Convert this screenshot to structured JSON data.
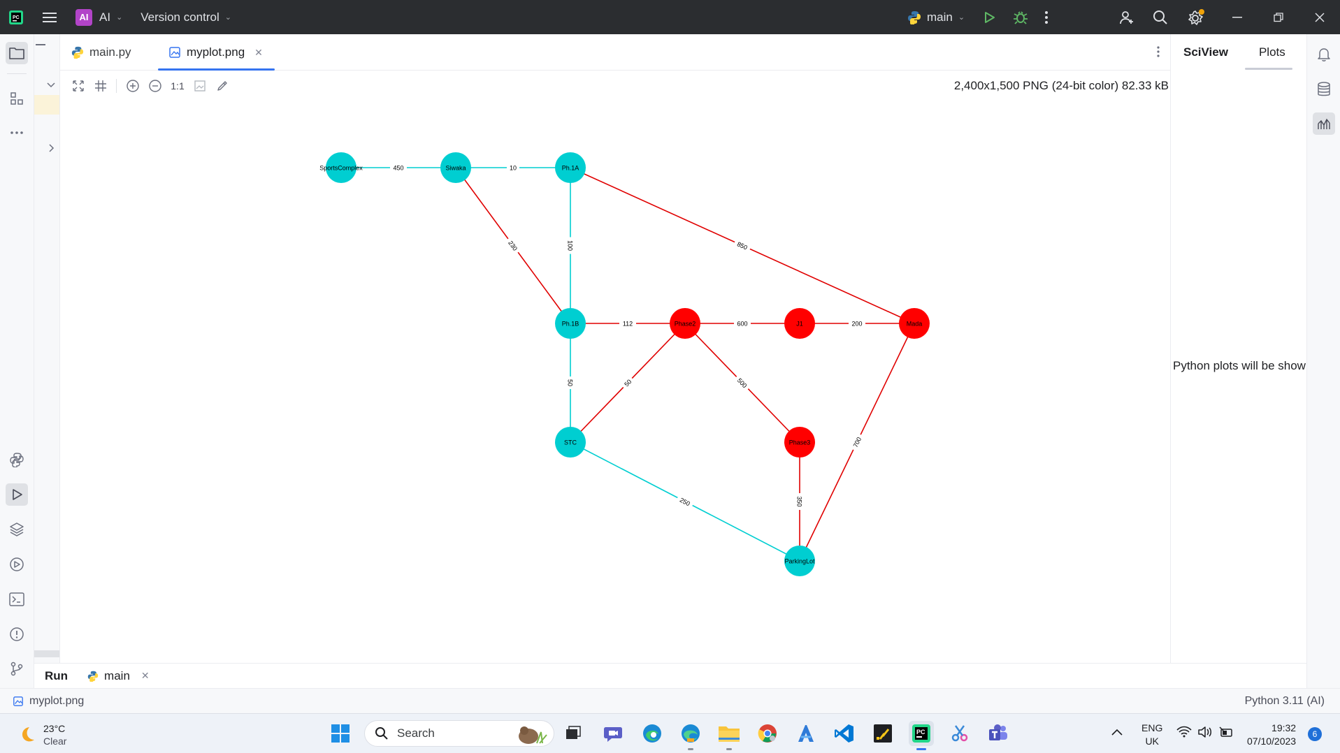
{
  "titlebar": {
    "project_badge": "AI",
    "project_name": "AI",
    "vcs_label": "Version control",
    "run_config": "main"
  },
  "tabs": [
    {
      "label": "main.py",
      "active": false
    },
    {
      "label": "myplot.png",
      "active": true
    }
  ],
  "image_toolbar": {
    "actual_size_label": "1:1",
    "image_info": "2,400x1,500 PNG (24-bit color) 82.33 kB"
  },
  "sciview": {
    "tab_sciview": "SciView",
    "tab_plots": "Plots",
    "empty_message": "Python plots will be shown here"
  },
  "runbar": {
    "run_label": "Run",
    "run_tab": "main"
  },
  "statusbar": {
    "file": "myplot.png",
    "interpreter": "Python 3.11 (AI)"
  },
  "taskbar": {
    "weather_temp": "23°C",
    "weather_desc": "Clear",
    "search_label": "Search",
    "lang_1": "ENG",
    "lang_2": "UK",
    "time": "19:32",
    "date": "07/10/2023",
    "notification_count": "6"
  },
  "colors": {
    "cyan_node": "#00ced1",
    "red_node": "#ff0000",
    "cyan_edge": "#00ced1",
    "red_edge": "#e00000",
    "accent": "#3574f0"
  },
  "graph": {
    "nodes": [
      {
        "id": "SportsComplex",
        "label": "SportsComplex",
        "color": "cyan"
      },
      {
        "id": "Siwaka",
        "label": "Siwaka",
        "color": "cyan"
      },
      {
        "id": "Ph.1A",
        "label": "Ph.1A",
        "color": "cyan"
      },
      {
        "id": "Ph.1B",
        "label": "Ph.1B",
        "color": "cyan"
      },
      {
        "id": "Phase2",
        "label": "Phase2",
        "color": "red"
      },
      {
        "id": "J1",
        "label": "J1",
        "color": "red"
      },
      {
        "id": "Mada",
        "label": "Mada",
        "color": "red"
      },
      {
        "id": "STC",
        "label": "STC",
        "color": "cyan"
      },
      {
        "id": "Phase3",
        "label": "Phase3",
        "color": "red"
      },
      {
        "id": "ParkingLot",
        "label": "ParkingLot",
        "color": "cyan"
      }
    ],
    "edges": [
      {
        "from": "SportsComplex",
        "to": "Siwaka",
        "weight": "450",
        "color": "cyan"
      },
      {
        "from": "Siwaka",
        "to": "Ph.1A",
        "weight": "10",
        "color": "cyan"
      },
      {
        "from": "Siwaka",
        "to": "Ph.1B",
        "weight": "230",
        "color": "red"
      },
      {
        "from": "Ph.1A",
        "to": "Ph.1B",
        "weight": "100",
        "color": "cyan"
      },
      {
        "from": "Ph.1A",
        "to": "Mada",
        "weight": "850",
        "color": "red"
      },
      {
        "from": "Ph.1B",
        "to": "Phase2",
        "weight": "112",
        "color": "red"
      },
      {
        "from": "Ph.1B",
        "to": "STC",
        "weight": "50",
        "color": "cyan"
      },
      {
        "from": "Phase2",
        "to": "J1",
        "weight": "600",
        "color": "red"
      },
      {
        "from": "Phase2",
        "to": "STC",
        "weight": "50",
        "color": "red"
      },
      {
        "from": "Phase2",
        "to": "Phase3",
        "weight": "500",
        "color": "red"
      },
      {
        "from": "J1",
        "to": "Mada",
        "weight": "200",
        "color": "red"
      },
      {
        "from": "STC",
        "to": "ParkingLot",
        "weight": "250",
        "color": "cyan"
      },
      {
        "from": "Phase3",
        "to": "ParkingLot",
        "weight": "350",
        "color": "red"
      },
      {
        "from": "Mada",
        "to": "ParkingLot",
        "weight": "700",
        "color": "red"
      }
    ]
  }
}
